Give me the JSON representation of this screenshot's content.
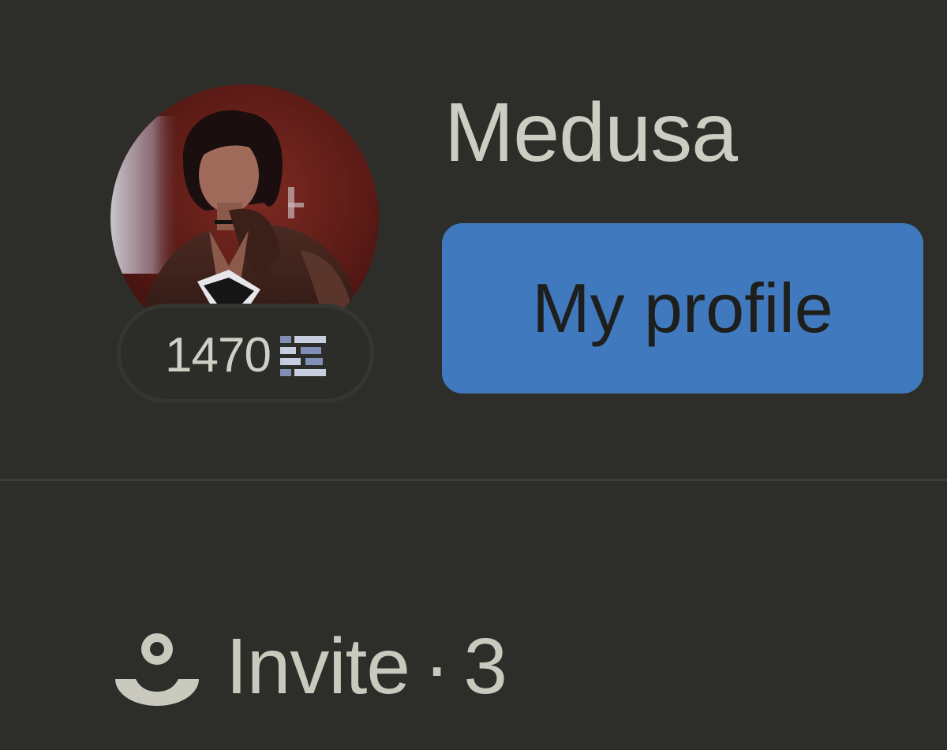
{
  "user": {
    "name": "Medusa",
    "avatar_alt": "avatar",
    "score": "1470",
    "score_icon": "stacked-bars-icon"
  },
  "actions": {
    "profile_button_label": "My profile"
  },
  "invite": {
    "label": "Invite",
    "separator": "·",
    "count": "3",
    "icon": "person-invite-icon"
  },
  "colors": {
    "background": "#2d2e2a",
    "primary_button": "#4179be",
    "text": "#cdcdc3"
  }
}
